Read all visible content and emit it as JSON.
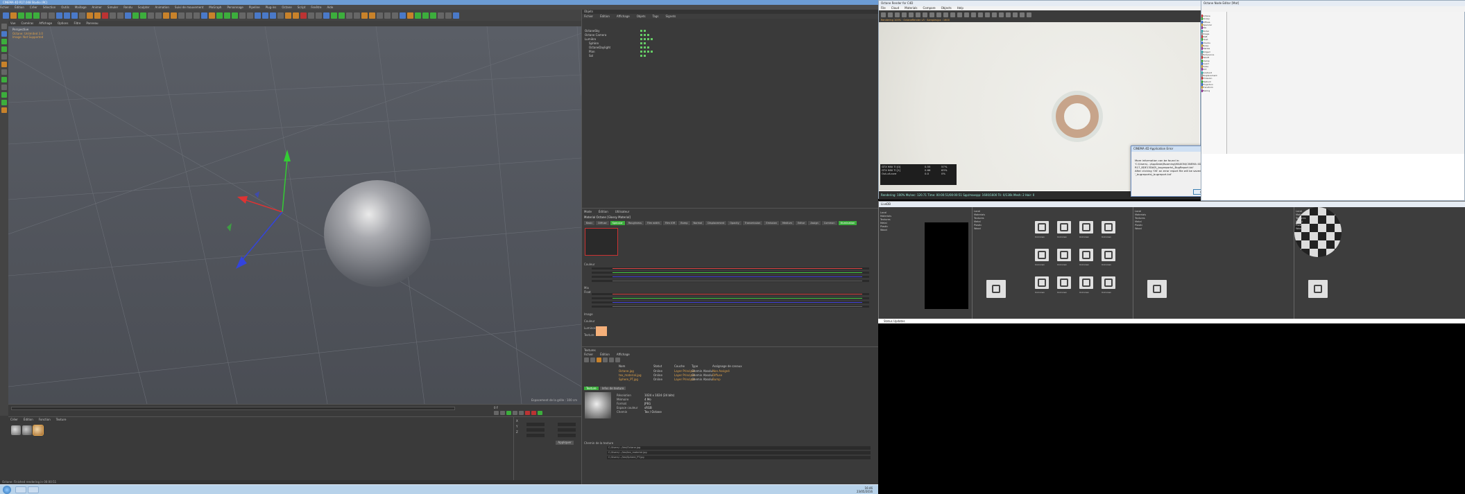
{
  "c4d": {
    "title": "CINEMA 4D R17.048 Studio (RC)",
    "menubar": [
      "Fichier",
      "Édition",
      "Créer",
      "Sélection",
      "Outils",
      "Maillage",
      "Animer",
      "Simuler",
      "Rendu",
      "Sculpter",
      "Animation",
      "Suivi de mouvement",
      "MoGraph",
      "Personnage",
      "Pipeline",
      "Plug-ins",
      "Octane",
      "Script",
      "Fenêtre",
      "Aide"
    ],
    "viewport_menubar": [
      "Vue",
      "Caméras",
      "Affichage",
      "Options",
      "Filtre",
      "Panneau"
    ],
    "viewport_label": "Perspective",
    "viewport_notes": [
      "Octane: Unlimited 3.0",
      "Image: Not Supported"
    ],
    "grid_info": "Espacement de la grille : 100 cm",
    "timeline_frame": "0 F",
    "mat_menubar": [
      "Créer",
      "Édition",
      "Fonction",
      "Texture"
    ],
    "coords": {
      "rows": [
        {
          "label": "X",
          "a": "0 cm",
          "b": "0 cm"
        },
        {
          "label": "Y",
          "a": "0 cm",
          "b": "0 cm"
        },
        {
          "label": "Z",
          "a": "0 cm",
          "b": "0 cm"
        }
      ],
      "apply": "Appliquer"
    },
    "status": "Octane: Finished rendering in 00:00:51"
  },
  "obj_mgr": {
    "tabs": "Objets",
    "menubar": [
      "Fichier",
      "Édition",
      "Affichage",
      "Objets",
      "Tags",
      "Signets"
    ],
    "rows": [
      "OctaneSky",
      "Octane Camera",
      "Lumière",
      "Sphère",
      "OctaneDaylight",
      "Plan",
      "Sol"
    ]
  },
  "attr_mgr": {
    "menubar": [
      "Mode",
      "Édition",
      "Utilisateur"
    ],
    "title": "Material Octane [Glossy Material]",
    "tabs": [
      "Basic",
      "Diffuse",
      "Specular",
      "Roughness",
      "Film width",
      "Film IOR",
      "Bump",
      "Normal",
      "Displacement",
      "Opacity",
      "Transmission",
      "Emission",
      "Medium",
      "Editor",
      "Assign",
      "Common",
      "Illumination"
    ],
    "labels": [
      "Couleur",
      "Mix",
      "Float",
      "Image",
      "Couleur",
      "Luminosité",
      "Texture"
    ]
  },
  "tex_mgr": {
    "head": "Textures",
    "menubar": [
      "Fichier",
      "Édition",
      "Affichage"
    ],
    "headers": [
      "Nom",
      "Statut",
      "Couche",
      "Type",
      "Assignage de canaux"
    ],
    "rows": [
      {
        "name": "Octane.jpg",
        "stat": "Online",
        "layer": "Layer Principal",
        "type": "Chemin Absolu",
        "ass": "Non Assigné"
      },
      {
        "name": "tex_material.jpg",
        "stat": "Online",
        "layer": "Layer Principal",
        "type": "Chemin Absolu",
        "ass": "Diffuse"
      },
      {
        "name": "Sphere_PT.jpg",
        "stat": "Online",
        "layer": "Layer Principal",
        "type": "Chemin Absolu",
        "ass": "Bump"
      }
    ],
    "info_tabs": [
      "Texture",
      "Infos de texture"
    ],
    "info": [
      {
        "k": "Résolution",
        "v": "1024 x 1024 (24 bits)"
      },
      {
        "k": "Mémoire",
        "v": "4 Mo"
      },
      {
        "k": "Format",
        "v": "JPEG"
      },
      {
        "k": "Espace couleur",
        "v": "sRGB"
      },
      {
        "k": "Chemin",
        "v": "Tex / Octane"
      }
    ],
    "path_lbl": "Chemin de la texture",
    "path_fields": [
      "C:/Users/…/tex/Octane.jpg",
      "C:/Users/…/tex/tex_material.jpg",
      "C:/Users/…/tex/Sphere_PT.jpg"
    ]
  },
  "taskbar": {
    "time": "16:46",
    "date": "23/05/2016"
  },
  "octane": {
    "title": "Octane Render for C4D",
    "menubar": [
      "File",
      "Cloud",
      "Materials",
      "Compare",
      "Objects",
      "Help"
    ],
    "status_top": "Rendering 100% · OctaneRender v3 · Samples/px : 1600",
    "gpu": [
      {
        "name": "GTX 980 Ti [0]",
        "a": "0.55",
        "b": "57%"
      },
      {
        "name": "GTX 980 Ti [1]",
        "a": "0.66",
        "b": "63%"
      },
      {
        "name": "Out-of-core",
        "a": "0.0",
        "b": "0%"
      }
    ],
    "stats": "Rendering: 100%   Ms/sec: 120.71   Time: 00:00:51/00:00:51   Spp/maxspp: 1600/1600   Tri: 0/130k   Mesh: 2   Hair: 0"
  },
  "error_dialog": {
    "title": "CINEMA 4D Application Error",
    "body": [
      "More information can be found in:",
      "'C:\\Users\\...\\AppData\\Roaming\\MAXON\\CINEMA 4D R17_8DE13DAD\\_bugreports\\_BugReport.txt'",
      "After clicking 'OK' an error report file will be saved as",
      "'_bugreports\\_bugreport.txt'"
    ],
    "ok": "OK"
  },
  "node_editor": {
    "title": "Octane Node Editor [Mat]",
    "list": [
      "Octane",
      "Glossy",
      "Diffuse",
      "Specular",
      "Mix",
      "Portal",
      "Image",
      "RGB",
      "Float",
      "Checks",
      "Noise",
      "Marble",
      "Ridged",
      "Turbulence",
      "Falloff",
      "Clamp",
      "Invert",
      "Scale",
      "Dirt",
      "Gradient",
      "Displacement",
      "Emission",
      "Medium",
      "Projection",
      "Transform",
      "Baking"
    ]
  },
  "livedb": {
    "title": "LiveDB",
    "tree": [
      "Local",
      "Materials",
      "Textures",
      "Metal",
      "Plastic",
      "Wood"
    ],
    "preview_caps": [
      "LiveDB"
    ],
    "panes": [
      "Local Materials",
      "Materials",
      "Octane LiveDB"
    ],
    "lock_caps": [
      "Unknown",
      "Unknown",
      "Unknown",
      "Unknown",
      "Unknown",
      "Unknown",
      "Unknown",
      "Unknown",
      "Unknown",
      "Unknown",
      "Unknown",
      "Unknown"
    ]
  },
  "status_updates": "Status Updates"
}
